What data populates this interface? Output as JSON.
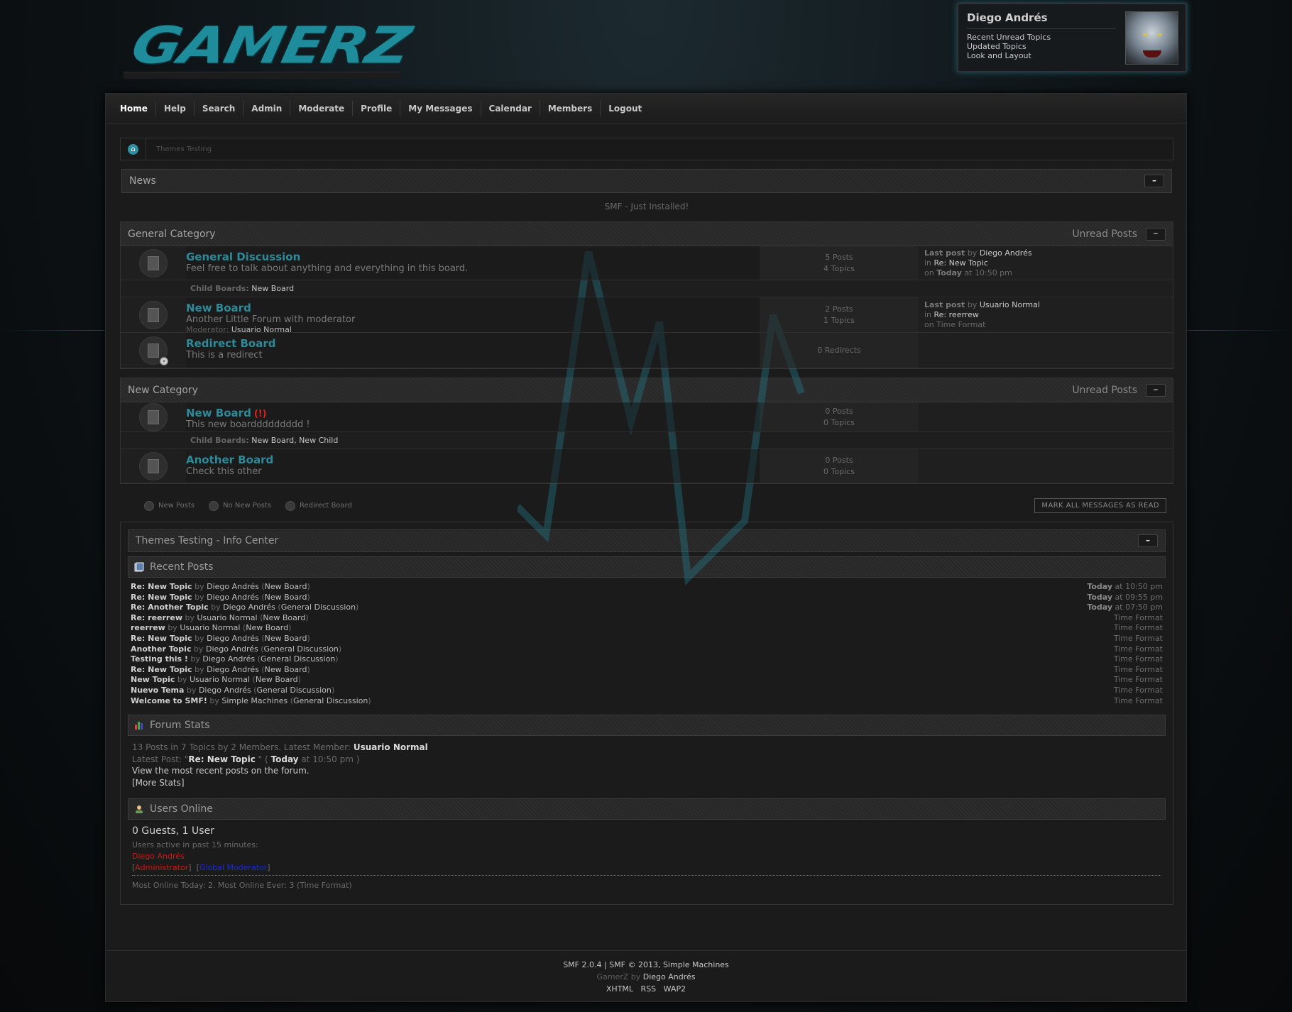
{
  "logo": {
    "text": "GAMERZ"
  },
  "user": {
    "name": "Diego Andrés",
    "links": [
      "Recent Unread Topics",
      "Updated Topics",
      "Look and Layout"
    ]
  },
  "menu": [
    "Home",
    "Help",
    "Search",
    "Admin",
    "Moderate",
    "Profile",
    "My Messages",
    "Calendar",
    "Members",
    "Logout"
  ],
  "breadcrumb": {
    "crumb": "Themes Testing"
  },
  "news": {
    "title": "News",
    "collapse": "–",
    "text": "SMF - Just Installed!"
  },
  "categories": [
    {
      "title": "General Category",
      "unread": "Unread Posts",
      "collapse": "–",
      "boards": [
        {
          "name": "General Discussion",
          "desc": "Feel free to talk about anything and everything in this board.",
          "stats": [
            "5 Posts",
            "4 Topics"
          ],
          "last": {
            "label": "Last post",
            "by": "by",
            "author": "Diego Andrés",
            "in": "in",
            "topic": "Re: New Topic",
            "on": "on",
            "when_bold": "Today",
            "when": "at 10:50 pm"
          },
          "child_label": "Child Boards:",
          "children": "New Board"
        },
        {
          "name": "New Board",
          "desc": "Another Little Forum with moderator",
          "mod_label": "Moderator:",
          "mod": "Usuario Normal",
          "stats": [
            "2 Posts",
            "1 Topics"
          ],
          "last": {
            "label": "Last post",
            "by": "by",
            "author": "Usuario Normal",
            "in": "in",
            "topic": "Re: reerrew",
            "on": "on Time Format"
          }
        },
        {
          "name": "Redirect Board",
          "desc": "This is a redirect",
          "stats": [
            "0 Redirects"
          ]
        }
      ]
    },
    {
      "title": "New Category",
      "unread": "Unread Posts",
      "collapse": "–",
      "boards": [
        {
          "name": "New Board",
          "new_flag": "(!)",
          "desc": "This new boarddddddddd !",
          "stats": [
            "0 Posts",
            "0 Topics"
          ],
          "child_label": "Child Boards:",
          "children": "New Board, New Child"
        },
        {
          "name": "Another Board",
          "desc": "Check this other",
          "stats": [
            "0 Posts",
            "0 Topics"
          ]
        }
      ]
    }
  ],
  "legend": {
    "new": "New Posts",
    "nonew": "No New Posts",
    "redirect": "Redirect Board",
    "mark_read": "MARK ALL MESSAGES AS READ"
  },
  "info_center": {
    "title": "Themes Testing - Info Center",
    "collapse": "–",
    "recent_title": "Recent Posts",
    "recent": [
      {
        "topic": "Re: New Topic",
        "author": "Diego Andrés",
        "board": "New Board",
        "day": "Today",
        "time": "at 10:50 pm"
      },
      {
        "topic": "Re: New Topic",
        "author": "Diego Andrés",
        "board": "New Board",
        "day": "Today",
        "time": "at 09:55 pm"
      },
      {
        "topic": "Re: Another Topic",
        "author": "Diego Andrés",
        "board": "General Discussion",
        "day": "Today",
        "time": "at 07:50 pm"
      },
      {
        "topic": "Re: reerrew",
        "author": "Usuario Normal",
        "board": "New Board",
        "day": "",
        "time": "Time Format"
      },
      {
        "topic": "reerrew",
        "author": "Usuario Normal",
        "board": "New Board",
        "day": "",
        "time": "Time Format"
      },
      {
        "topic": "Re: New Topic",
        "author": "Diego Andrés",
        "board": "New Board",
        "day": "",
        "time": "Time Format"
      },
      {
        "topic": "Another Topic",
        "author": "Diego Andrés",
        "board": "General Discussion",
        "day": "",
        "time": "Time Format"
      },
      {
        "topic": "Testing this !",
        "author": "Diego Andrés",
        "board": "General Discussion",
        "day": "",
        "time": "Time Format"
      },
      {
        "topic": "Re: New Topic",
        "author": "Diego Andrés",
        "board": "New Board",
        "day": "",
        "time": "Time Format"
      },
      {
        "topic": "New Topic",
        "author": "Usuario Normal",
        "board": "New Board",
        "day": "",
        "time": "Time Format"
      },
      {
        "topic": "Nuevo Tema",
        "author": "Diego Andrés",
        "board": "General Discussion",
        "day": "",
        "time": "Time Format"
      },
      {
        "topic": "Welcome to SMF!",
        "author": "Simple Machines",
        "board": "General Discussion",
        "day": "",
        "time": "Time Format"
      }
    ],
    "stats_title": "Forum Stats",
    "stats_line1": "13 Posts in 7 Topics by 2 Members. Latest Member:",
    "stats_latest_member": "Usuario Normal",
    "stats_line2_pre": "Latest Post:",
    "stats_latest_post": "Re: New Topic",
    "stats_latest_day": "Today",
    "stats_latest_time": "at 10:50 pm",
    "stats_line3": "View the most recent posts on the forum.",
    "stats_more": "[More Stats]",
    "online_title": "Users Online",
    "online_count": "0 Guests, 1 User",
    "online_active": "Users active in past 15 minutes:",
    "online_user": "Diego Andrés",
    "online_group1": "Administrator",
    "online_group2": "Global Moderator",
    "online_most": "Most Online Today: 2. Most Online Ever: 3 (Time Format)"
  },
  "footer": {
    "line1": "SMF 2.0.4 | SMF © 2013, Simple Machines",
    "line2_pre": "GamerZ by",
    "line2_author": "Diego Andrés",
    "links": [
      "XHTML",
      "RSS",
      "WAP2"
    ]
  },
  "colors": {
    "accent": "#2e8a99",
    "background": "#1b1b1b",
    "glow": "#3cc7d6"
  }
}
